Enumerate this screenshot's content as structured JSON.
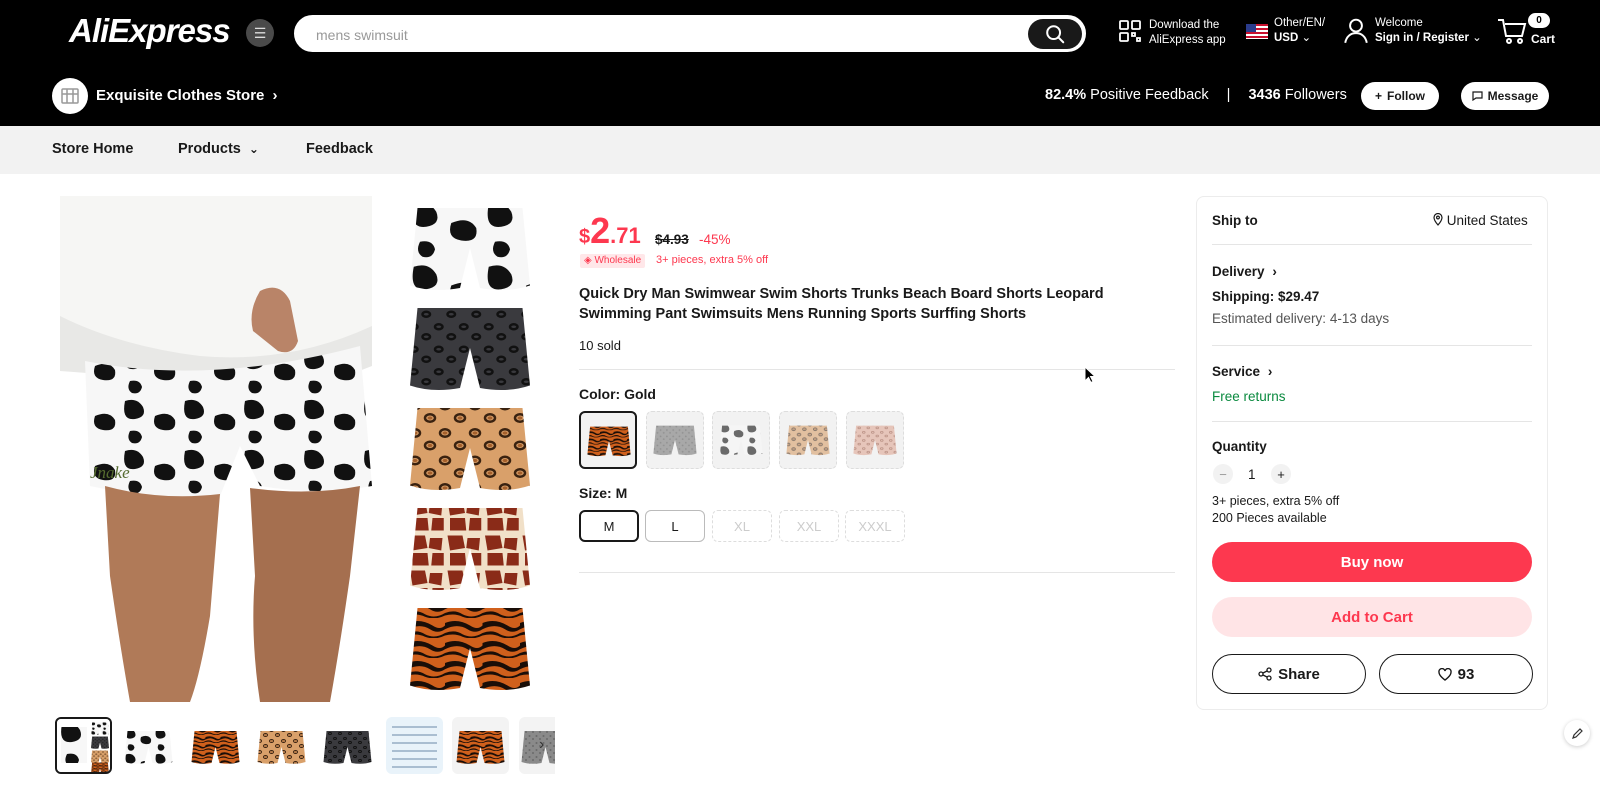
{
  "header": {
    "logo": "AliExpress",
    "search_placeholder": "mens swimsuit",
    "download_line1": "Download the",
    "download_line2": "AliExpress app",
    "locale_line1": "Other/EN/",
    "locale_line2": "USD",
    "welcome": "Welcome",
    "signin": "Sign in / Register",
    "cart_count": "0",
    "cart_label": "Cart"
  },
  "store": {
    "name": "Exquisite Clothes Store",
    "positive_pct": "82.4%",
    "positive_label": "Positive Feedback",
    "separator": "|",
    "followers_count": "3436",
    "followers_label": "Followers",
    "follow_label": "Follow",
    "message_label": "Message"
  },
  "store_nav": {
    "home": "Store Home",
    "products": "Products",
    "feedback": "Feedback"
  },
  "product": {
    "currency": "$",
    "price_int": "2",
    "price_dec": ".71",
    "original_price": "$4.93",
    "discount": "-45%",
    "wholesale_badge": "Wholesale",
    "wholesale_note": "3+ pieces, extra 5% off",
    "title": "Quick Dry Man Swimwear Swim Shorts Trunks Beach Board Shorts Leopard Swimming Pant Swimsuits Mens Running Sports Surffing Shorts",
    "sold": "10 sold",
    "color_label": "Color: Gold",
    "size_label": "Size: M",
    "sizes": [
      "M",
      "L",
      "XL",
      "XXL",
      "XXXL"
    ],
    "main_image_text": "Jnake"
  },
  "panel": {
    "ship_to": "Ship to",
    "country": "United States",
    "delivery": "Delivery",
    "shipping": "Shipping: $29.47",
    "est_label": "Estimated delivery:",
    "est_value": "4-13 days",
    "service": "Service",
    "free_returns": "Free returns",
    "quantity_label": "Quantity",
    "quantity": "1",
    "qty_note1": "3+ pieces, extra 5% off",
    "qty_note2": "200 Pieces available",
    "buy_now": "Buy now",
    "add_to_cart": "Add to Cart",
    "share": "Share",
    "wishlist_count": "93"
  },
  "colors": {
    "accent": "#fd384f",
    "green": "#0a8a3f",
    "header_bg": "#000000"
  }
}
